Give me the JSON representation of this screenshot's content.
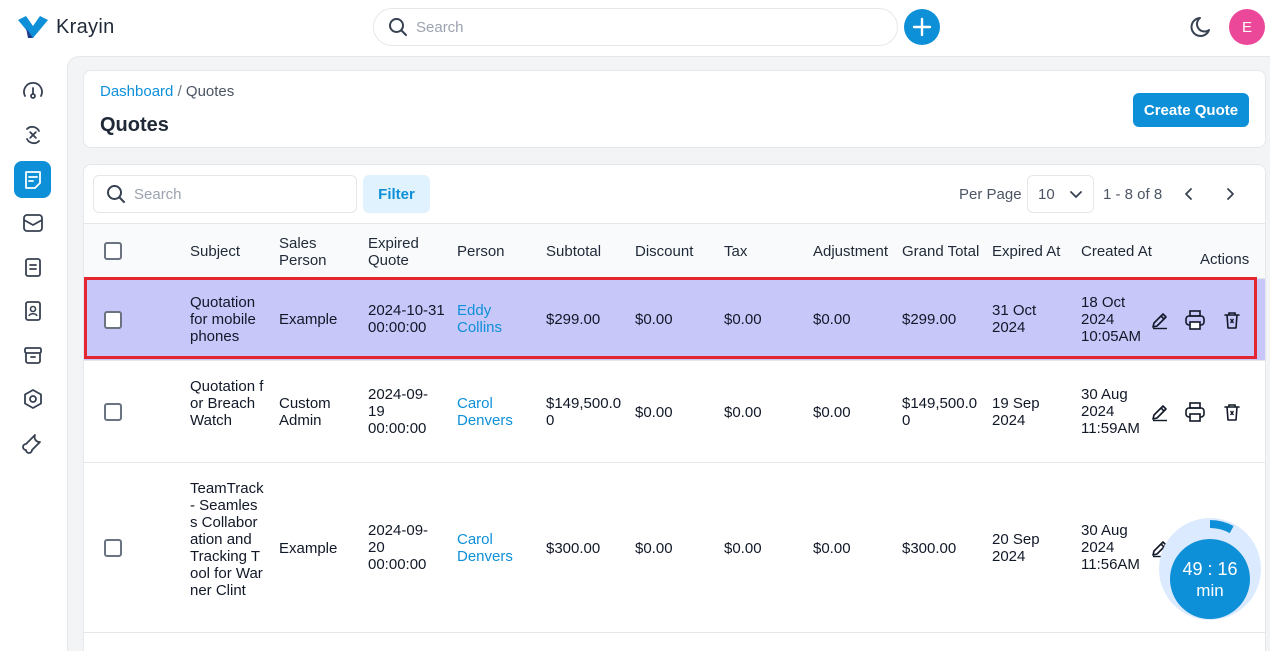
{
  "app": {
    "name": "Krayin"
  },
  "topbar": {
    "search_placeholder": "Search"
  },
  "user": {
    "initial": "E"
  },
  "breadcrumb": {
    "root": "Dashboard",
    "separator": "/",
    "current": "Quotes"
  },
  "page": {
    "title": "Quotes",
    "create_label": "Create Quote"
  },
  "toolbar": {
    "search_placeholder": "Search",
    "filter_label": "Filter",
    "per_page_label": "Per Page",
    "per_page_value": "10",
    "page_info": "1 - 8 of 8"
  },
  "columns": {
    "subject": "Subject",
    "sales_person": "Sales Person",
    "expired_quote": "Expired Quote",
    "person": "Person",
    "subtotal": "Subtotal",
    "discount": "Discount",
    "tax": "Tax",
    "adjustment": "Adjustment",
    "grand_total": "Grand Total",
    "expired_at": "Expired At",
    "created_at": "Created At",
    "actions": "Actions"
  },
  "rows": [
    {
      "subject": "Quotation for mobile phones",
      "sales_person": "Example",
      "expired_quote": "2024-10-31 00:00:00",
      "person": "Eddy Collins",
      "subtotal": "$299.00",
      "discount": "$0.00",
      "tax": "$0.00",
      "adjustment": "$0.00",
      "grand_total": "$299.00",
      "expired_at": "31 Oct 2024",
      "created_at": "18 Oct 2024 10:05AM"
    },
    {
      "subject": "Quotation for BreachWatch",
      "sales_person": "Custom Admin",
      "expired_quote": "2024-09-19 00:00:00",
      "person": "Carol Denvers",
      "subtotal": "$149,500.00",
      "discount": "$0.00",
      "tax": "$0.00",
      "adjustment": "$0.00",
      "grand_total": "$149,500.00",
      "expired_at": "19 Sep 2024",
      "created_at": "30 Aug 2024 11:59AM"
    },
    {
      "subject": "TeamTrack - Seamless Collaboration and Tracking Tool for Warner Clint",
      "sales_person": "Example",
      "expired_quote": "2024-09-20 00:00:00",
      "person": "Carol Denvers",
      "subtotal": "$300.00",
      "discount": "$0.00",
      "tax": "$0.00",
      "adjustment": "$0.00",
      "grand_total": "$300.00",
      "expired_at": "20 Sep 2024",
      "created_at": "30 Aug 2024 11:56AM"
    }
  ],
  "timer": {
    "time": "49 : 16",
    "unit": "min",
    "progress": 0.08
  },
  "colors": {
    "accent": "#0e90d9",
    "highlight_row": "#c7c7fa",
    "highlight_border": "#e3262f",
    "avatar": "#ec4899"
  }
}
